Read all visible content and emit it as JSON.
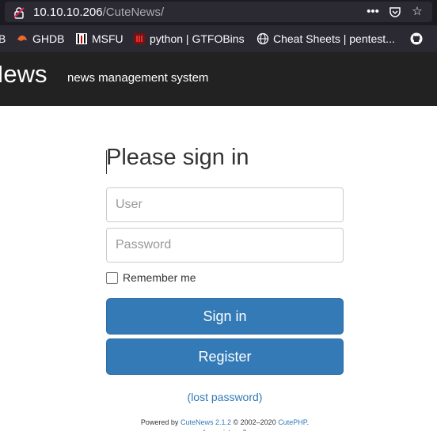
{
  "browser": {
    "url_host": "10.10.10.206",
    "url_path": "/CuteNews/",
    "actions": {
      "more": "•••",
      "pocket": "pocket-icon",
      "bookmark_star": "☆"
    }
  },
  "bookmarks": [
    {
      "label": "B",
      "icon": "none"
    },
    {
      "label": "GHDB",
      "icon": "ghdb-icon"
    },
    {
      "label": "MSFU",
      "icon": "msfu-icon"
    },
    {
      "label": "python | GTFOBins",
      "icon": "gtfobins-icon"
    },
    {
      "label": "Cheat Sheets | pentest...",
      "icon": "globe-icon"
    },
    {
      "label": "",
      "icon": "github-icon"
    }
  ],
  "site": {
    "brand": "News",
    "tagline": "news management system"
  },
  "login": {
    "title": "Please sign in",
    "user_placeholder": "User",
    "password_placeholder": "Password",
    "remember_label": "Remember me",
    "signin_label": "Sign in",
    "register_label": "Register",
    "lost_password": "(lost password)"
  },
  "footer": {
    "powered_by": "Powered by",
    "product": "CuteNews 2.1.2",
    "copyright": "© 2002–2020",
    "vendor": "CutePHP",
    "period": ".",
    "cut_line": "(unregistered)"
  },
  "colors": {
    "primary": "#337ab7",
    "header_bg": "#222222",
    "browser_bg": "#1c1b22"
  }
}
